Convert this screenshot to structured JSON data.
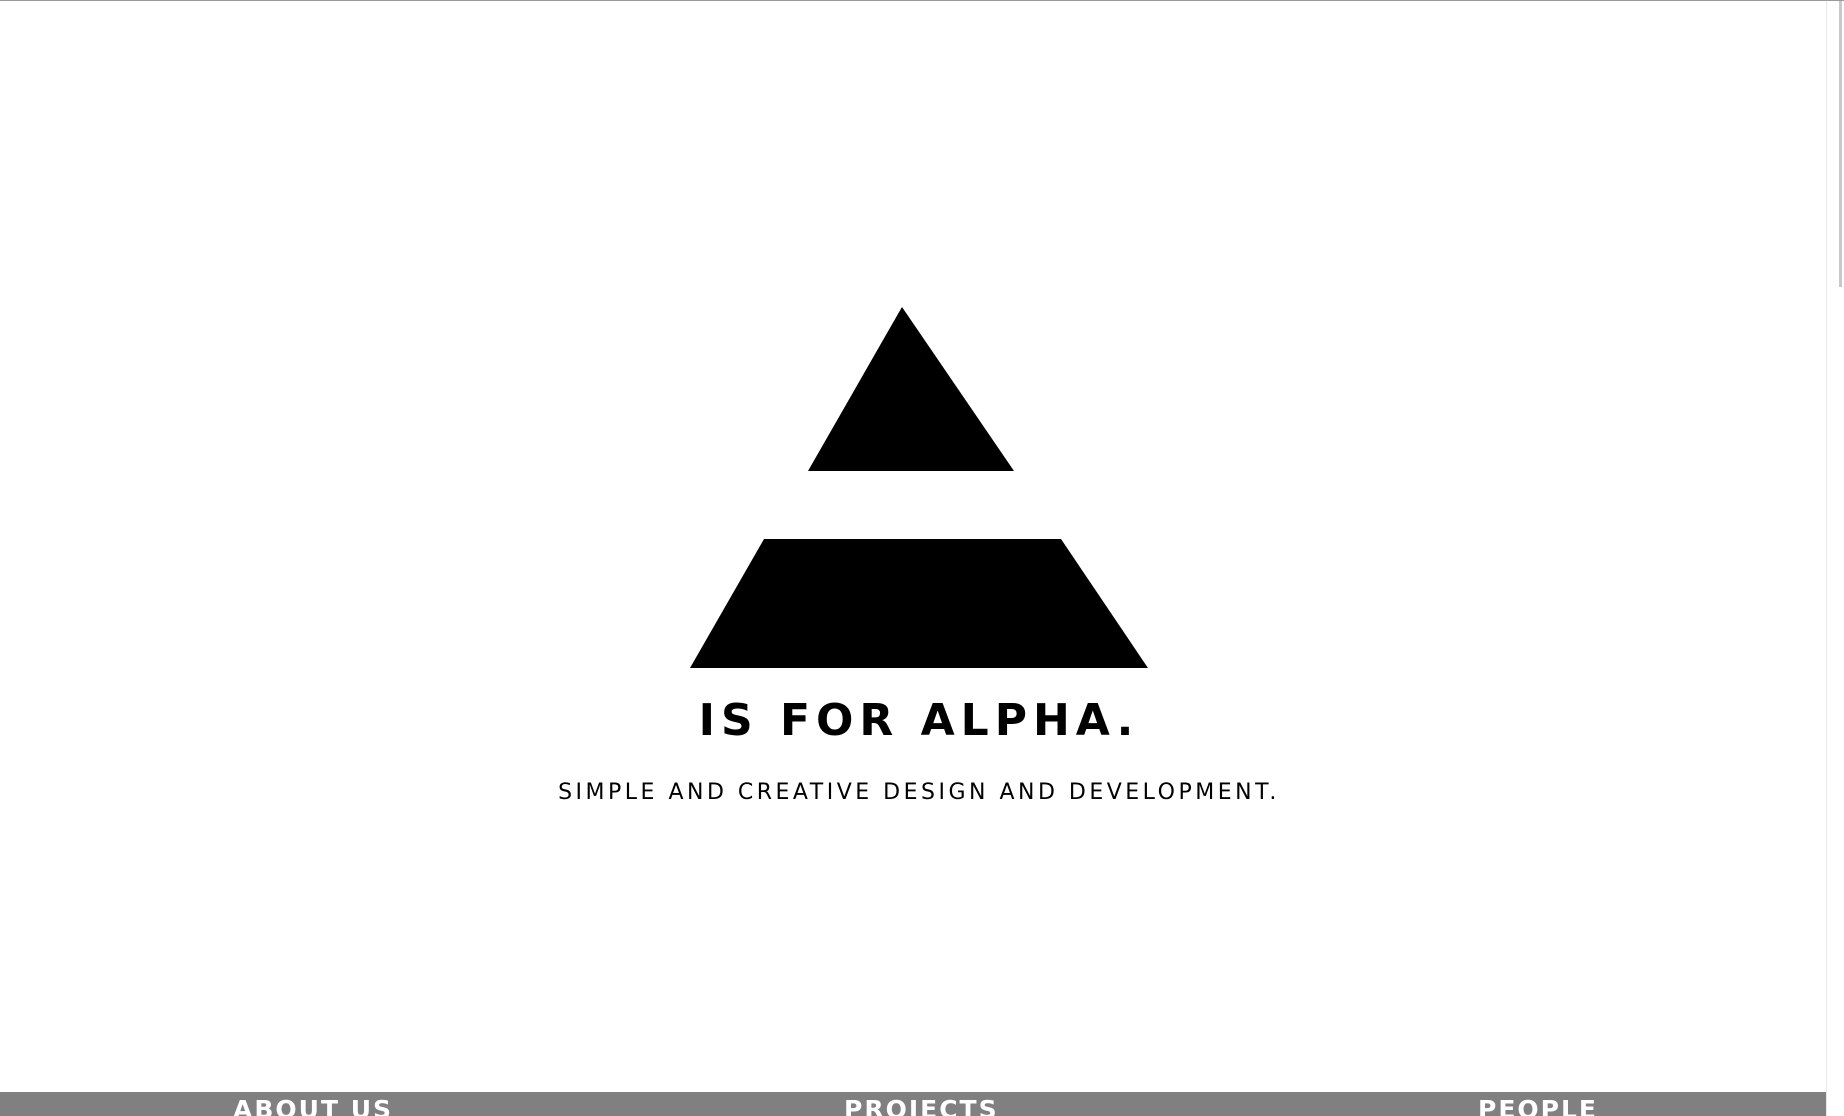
{
  "brand": {
    "logo_icon": "alpha-pyramid-icon",
    "headline": "IS FOR ALPHA.",
    "tagline": "SIMPLE AND CREATIVE DESIGN AND DEVELOPMENT."
  },
  "nav": {
    "items": [
      {
        "label": "ABOUT US"
      },
      {
        "label": "PROJECTS"
      },
      {
        "label": "PEOPLE"
      }
    ]
  },
  "colors": {
    "background": "#ffffff",
    "logo": "#000000",
    "nav_background": "#808080",
    "nav_text": "#ffffff"
  }
}
